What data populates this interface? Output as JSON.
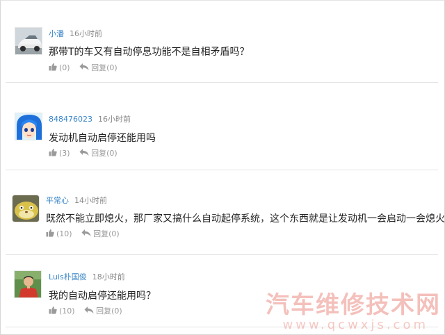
{
  "comments": [
    {
      "username": "小潘",
      "time": "16小时前",
      "text": "那带T的车又有自动停息功能不是自相矛盾吗？",
      "likes": "(0)",
      "reply_label": "回复",
      "replies": "(0)"
    },
    {
      "username": "848476023",
      "time": "16小时前",
      "text": "发动机自动启停还能用吗",
      "likes": "(3)",
      "reply_label": "回复",
      "replies": "(0)"
    },
    {
      "username": "平常心",
      "time": "14小时前",
      "text": "既然不能立即熄火，那厂家又搞什么自动起停系统，这个东西就是让发动机一会启动一会熄火的",
      "likes": "(10)",
      "reply_label": "回复",
      "replies": "(0)"
    },
    {
      "username": "Luis朴国俊",
      "time": "18小时前",
      "text": "我的自动启停还能用吗？",
      "likes": "(10)",
      "reply_label": "回复",
      "replies": "(0)"
    }
  ],
  "watermark": {
    "title": "汽车维修技术网",
    "url": "www.qcwxjs.com"
  },
  "colors": {
    "username": "#3a86c8",
    "meta": "#888888",
    "action": "#999999",
    "watermark": "#de3c2c"
  }
}
